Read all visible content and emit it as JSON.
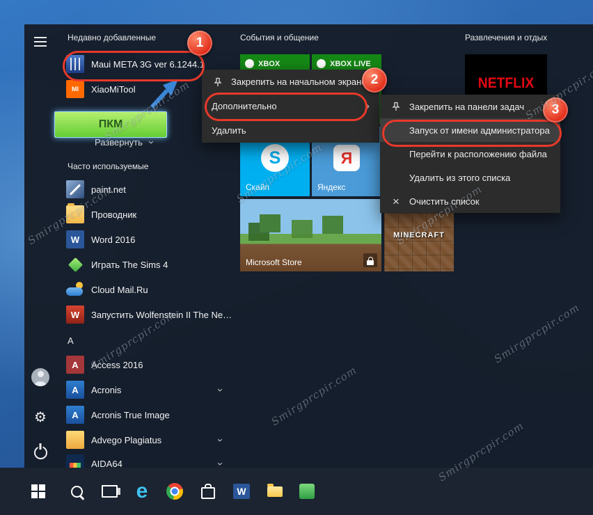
{
  "watermark": "Smirgprcpir.com",
  "markers": {
    "m1": "1",
    "m2": "2",
    "m3": "3"
  },
  "callout": {
    "pkm": "ПКМ"
  },
  "icons": {
    "chevron_right": "›",
    "chevron_down": "›",
    "multiply_x": "×",
    "gear": "⚙"
  },
  "app_list": {
    "recent_header": "Недавно добавленные",
    "recent": [
      {
        "label": "Maui META 3G ver 6.1244.1"
      },
      {
        "label": "XiaoMiTool",
        "icon_text": "MI"
      }
    ],
    "expand": "Развернуть",
    "frequent_header": "Часто используемые",
    "frequent": [
      {
        "label": "paint.net"
      },
      {
        "label": "Проводник"
      },
      {
        "label": "Word 2016",
        "icon_text": "W"
      },
      {
        "label": "Играть The Sims 4"
      },
      {
        "label": "Cloud Mail.Ru"
      },
      {
        "label": "Запустить Wolfenstein II The New...",
        "icon_text": "W"
      }
    ],
    "letter_header": "A",
    "alpha": [
      {
        "label": "Access 2016",
        "icon_text": "A"
      },
      {
        "label": "Acronis",
        "icon_text": "A"
      },
      {
        "label": "Acronis True Image",
        "icon_text": "A"
      },
      {
        "label": "Advego Plagiatus"
      },
      {
        "label": "AIDA64"
      }
    ]
  },
  "tiles": {
    "events_header": "События и общение",
    "fun_header": "Развлечения и отдых",
    "xbox": "XBOX",
    "xbox_live": "XBOX LIVE",
    "netflix": "NETFLIX",
    "skype": {
      "label": "Скайп",
      "icon_text": "S"
    },
    "yandex": {
      "label": "Яндекс",
      "icon_text": "Я"
    },
    "store": {
      "label": "Microsoft Store"
    },
    "minecraft": {
      "label": "MINECRAFT"
    }
  },
  "context_menu": {
    "pin_start": "Закрепить на начальном экране",
    "more": "Дополнительно",
    "delete": "Удалить"
  },
  "submenu": {
    "pin_taskbar": "Закрепить на панели задач",
    "run_admin": "Запуск от имени администратора",
    "open_location": "Перейти к расположению файла",
    "remove_list": "Удалить из этого списка",
    "clear_list": "Очистить список"
  },
  "taskbar": {
    "edge_letter": "e",
    "word_letter": "W"
  }
}
